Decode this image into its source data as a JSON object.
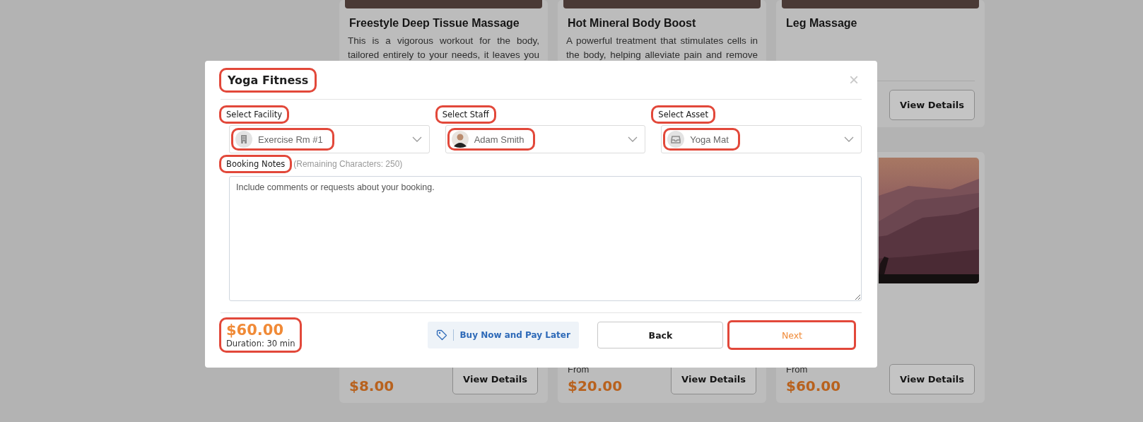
{
  "top_cards": [
    {
      "title": "Freestyle Deep Tissue Massage",
      "description": "This is a vigorous workout for the body, tailored entirely to your needs, it leaves you"
    },
    {
      "title": "Hot Mineral Body Boost",
      "description": "A powerful treatment that stimulates cells in the body, helping alleviate pain and remove"
    },
    {
      "title": "Leg Massage",
      "button": "View Details"
    }
  ],
  "bottom_cards": [
    {
      "price": "$8.00",
      "button": "View Details"
    },
    {
      "from_label": "From",
      "price": "$20.00",
      "button": "View Details"
    },
    {
      "kind": "picture",
      "from_label": "From",
      "price": "$60.00",
      "button": "View Details"
    }
  ],
  "modal": {
    "title": "Yoga Fitness",
    "title_highlighted": true,
    "close": "×",
    "selects": [
      {
        "kind": "facility",
        "label": "Select Facility",
        "value": "Exercise Rm #1",
        "highlighted": true
      },
      {
        "kind": "staff",
        "label": "Select Staff",
        "value": "Adam Smith",
        "highlighted": true
      },
      {
        "kind": "asset",
        "label": "Select Asset",
        "value": "Yoga Mat",
        "highlighted": true
      }
    ],
    "notes": {
      "label": "Booking Notes",
      "label_highlighted": true,
      "hint": "(Remaining Characters: 250)",
      "placeholder": "Include comments or requests about your booking."
    },
    "price": "$60.00",
    "duration": "Duration: 30 min",
    "price_highlighted": true,
    "pay_later": "Buy Now and Pay Later",
    "buttons": [
      {
        "kind": "secondary",
        "label": "Back",
        "highlighted": false
      },
      {
        "kind": "primary",
        "label": "Next",
        "highlighted": true
      }
    ]
  }
}
